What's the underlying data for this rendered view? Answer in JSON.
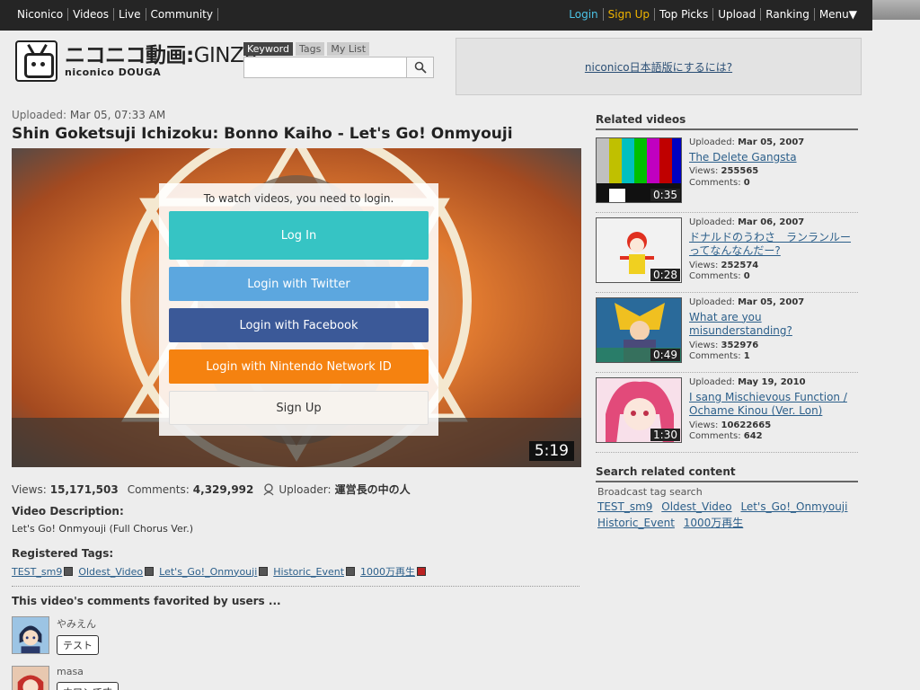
{
  "topbar": {
    "left": [
      "Niconico",
      "Videos",
      "Live",
      "Community"
    ],
    "login": "Login",
    "signup": "Sign Up",
    "right": [
      "Top Picks",
      "Upload",
      "Ranking",
      "Menu▼"
    ]
  },
  "logo": {
    "main": "ニコニコ動画",
    "sep": ":",
    "ginza": "GINZA",
    "sub": "niconico DOUGA"
  },
  "search": {
    "tabs": [
      "Keyword",
      "Tags",
      "My List"
    ],
    "value": ""
  },
  "banner": {
    "text": "niconico日本語版にするには?"
  },
  "video": {
    "uploaded_label": "Uploaded:",
    "uploaded_date": "Mar 05, 07:33 AM",
    "title": "Shin Goketsuji Ichizoku: Bonno Kaiho - Let's Go! Onmyouji",
    "duration": "5:19",
    "views_label": "Views:",
    "views": "15,171,503",
    "comments_label": "Comments:",
    "comments": "4,329,992",
    "uploader_label": "Uploader:",
    "uploader": "運営長の中の人",
    "desc_heading": "Video Description:",
    "description": "Let's Go! Onmyouji (Full Chorus Ver.)",
    "tags_heading": "Registered Tags:",
    "tags": [
      "TEST_sm9",
      "Oldest_Video",
      "Let's_Go!_Onmyouji",
      "Historic_Event",
      "1000万再生"
    ],
    "fav_heading": "This video's comments favorited by users ..."
  },
  "login": {
    "message": "To watch videos, you need to login.",
    "login": "Log In",
    "twitter": "Login with Twitter",
    "facebook": "Login with Facebook",
    "nintendo": "Login with Nintendo Network ID",
    "signup": "Sign Up"
  },
  "comments": [
    {
      "user": "やみえん",
      "text": "テスト"
    },
    {
      "user": "masa",
      "text": "ホワンです"
    }
  ],
  "related": {
    "heading": "Related videos",
    "uploaded_label": "Uploaded:",
    "views_label": "Views:",
    "comments_label": "Comments:",
    "items": [
      {
        "date": "Mar 05, 2007",
        "title": "The Delete Gangsta",
        "views": "255565",
        "comments": "0",
        "duration": "0:35"
      },
      {
        "date": "Mar 06, 2007",
        "title": "ドナルドのうわさ　ランランルーってなんなんだー?",
        "views": "252574",
        "comments": "0",
        "duration": "0:28"
      },
      {
        "date": "Mar 05, 2007",
        "title": "What are you misunderstanding?",
        "views": "352976",
        "comments": "1",
        "duration": "0:49"
      },
      {
        "date": "May 19, 2010",
        "title": "I sang Mischievous Function / Ochame Kinou (Ver. Lon)",
        "views": "10622665",
        "comments": "642",
        "duration": "1:30"
      }
    ]
  },
  "search_related": {
    "heading": "Search related content",
    "sub": "Broadcast tag search",
    "tags": [
      "TEST_sm9",
      "Oldest_Video",
      "Let's_Go!_Onmyouji",
      "Historic_Event",
      "1000万再生"
    ]
  }
}
